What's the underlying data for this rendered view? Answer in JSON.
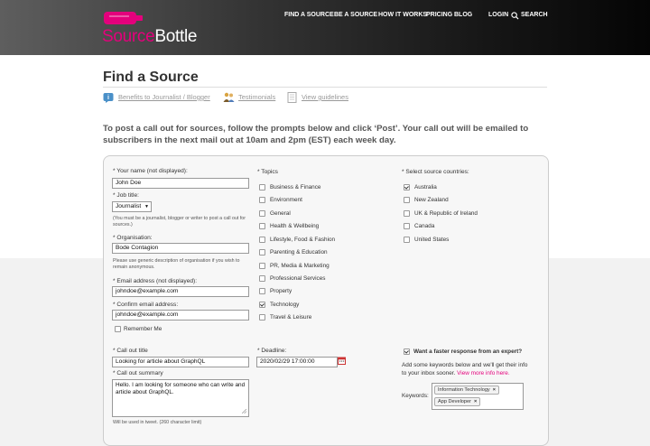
{
  "brand": {
    "name_part1": "Source",
    "name_part2": "Bottle",
    "accent": "#e4007c"
  },
  "nav": {
    "items": [
      "FIND A SOURCE",
      "BE A SOURCE",
      "HOW IT WORKS",
      "PRICING",
      "BLOG"
    ],
    "login": "LOGIN",
    "search": "SEARCH"
  },
  "page": {
    "title": "Find a Source",
    "subnav": [
      "Benefits to Journalist / Blogger",
      "Testimonials",
      "View guidelines"
    ],
    "intro": "To post a call out for sources, follow the prompts below and click ‘Post’. Your call out will be emailed to subscribers in the next mail out at 10am and 2pm (EST) each week day."
  },
  "form": {
    "name_label": "* Your name (not displayed):",
    "name_value": "John Doe",
    "job_label": "* Job title:",
    "job_value": "Journalist",
    "job_note": "(You must be a journalist, blogger or writer to post a call out for sources.)",
    "org_label": "* Organisation:",
    "org_value": "Bode Contagion",
    "org_note": "Please use generic description of organisation if you wish to remain anonymous.",
    "email_label": "* Email address (not displayed):",
    "email_value": "johndoe@example.com",
    "confirm_label": "* Confirm email address:",
    "confirm_value": "johndoe@example.com",
    "remember_label": "Remember Me",
    "callout_title_label": "* Call out title",
    "callout_title_value": "Looking for article about GraphQL",
    "deadline_label": "* Deadline:",
    "deadline_value": "2020/02/29 17:00:00",
    "summary_label": "* Call out summary",
    "summary_value": "Hello. I am looking for someone who can write and article about GraphQL.",
    "summary_note": "Will be used in tweet. (260 character limit)"
  },
  "topics": {
    "label": "* Topics",
    "items": [
      {
        "label": "Business & Finance",
        "checked": false
      },
      {
        "label": "Environment",
        "checked": false
      },
      {
        "label": "General",
        "checked": false
      },
      {
        "label": "Health & Wellbeing",
        "checked": false
      },
      {
        "label": "Lifestyle, Food & Fashion",
        "checked": false
      },
      {
        "label": "Parenting & Education",
        "checked": false
      },
      {
        "label": "PR, Media & Marketing",
        "checked": false
      },
      {
        "label": "Professional Services",
        "checked": false
      },
      {
        "label": "Property",
        "checked": false
      },
      {
        "label": "Technology",
        "checked": true
      },
      {
        "label": "Travel & Leisure",
        "checked": false
      }
    ]
  },
  "countries": {
    "label": "* Select source countries:",
    "items": [
      {
        "label": "Australia",
        "checked": true
      },
      {
        "label": "New Zealand",
        "checked": false
      },
      {
        "label": "UK & Republic of Ireland",
        "checked": false
      },
      {
        "label": "Canada",
        "checked": false
      },
      {
        "label": "United States",
        "checked": false
      }
    ]
  },
  "expert": {
    "label": "Want a faster response from an expert?",
    "checked": true,
    "text1": "Add some keywords below and we'll get their info",
    "text2": "to your inbox sooner.",
    "view_more": "View more info here.",
    "keywords_label": "Keywords:",
    "keywords": [
      "Information Technology",
      "App Developer"
    ]
  }
}
